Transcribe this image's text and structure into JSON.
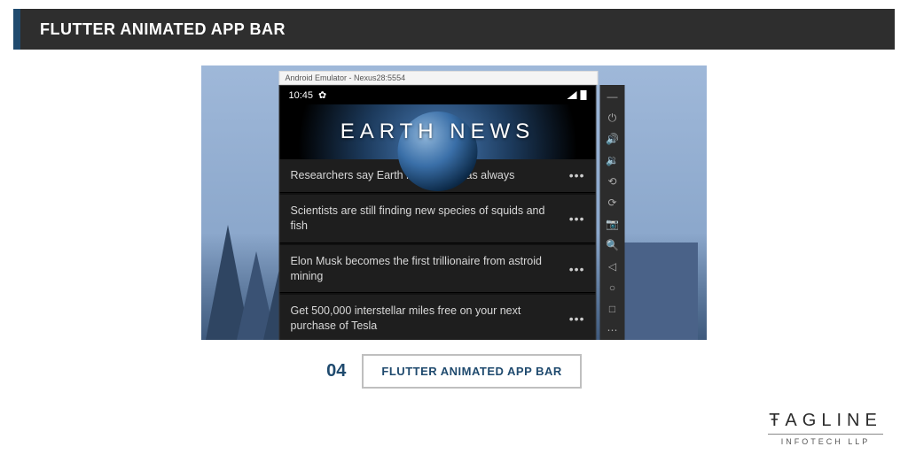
{
  "title_bar": {
    "text": "FLUTTER ANIMATED APP BAR"
  },
  "emulator": {
    "window_title": "Android Emulator - Nexus28:5554",
    "status_bar": {
      "time": "10:45"
    },
    "app_title": "EARTH NEWS",
    "news": [
      {
        "headline": "Researchers say Earth is as boring as always"
      },
      {
        "headline": "Scientists are still finding new species of squids and fish"
      },
      {
        "headline": "Elon Musk becomes the first trillionaire from astroid mining"
      },
      {
        "headline": "Get 500,000 interstellar miles free on your next purchase of Tesla"
      }
    ],
    "toolbar_icons": [
      "minimize-icon",
      "power-icon",
      "volume-up-icon",
      "volume-down-icon",
      "rotate-left-icon",
      "rotate-right-icon",
      "camera-icon",
      "zoom-icon",
      "back-icon",
      "home-icon",
      "overview-icon",
      "more-icon"
    ]
  },
  "caption": {
    "number": "04",
    "label": "FLUTTER ANIMATED APP BAR"
  },
  "brand": {
    "name": "ŦAGLINE",
    "subtitle": "INFOTECH LLP"
  }
}
